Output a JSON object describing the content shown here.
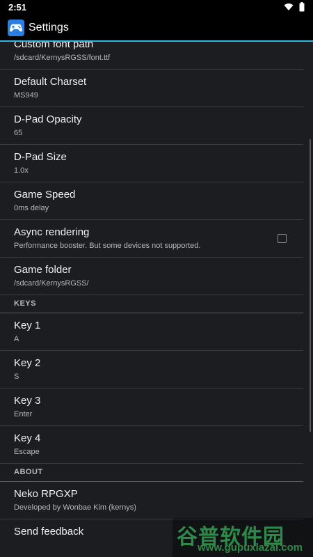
{
  "status_bar": {
    "time": "2:51",
    "icons": [
      "wifi-icon",
      "battery-icon"
    ]
  },
  "action_bar": {
    "title": "Settings",
    "icon": "gamepad-icon",
    "accent": "#33b5e5"
  },
  "preferences_top": [
    {
      "title": "Custom font path",
      "summary": "/sdcard/KernysRGSS/font.ttf"
    },
    {
      "title": "Default Charset",
      "summary": "MS949"
    },
    {
      "title": "D-Pad Opacity",
      "summary": "65"
    },
    {
      "title": "D-Pad Size",
      "summary": "1.0x"
    },
    {
      "title": "Game Speed",
      "summary": "0ms delay"
    },
    {
      "title": "Async rendering",
      "summary": "Performance booster. But some devices not supported.",
      "checked": false
    },
    {
      "title": "Game folder",
      "summary": "/sdcard/KernysRGSS/"
    }
  ],
  "keys_category": "KEYS",
  "keys": [
    {
      "title": "Key 1",
      "summary": "A"
    },
    {
      "title": "Key 2",
      "summary": "S"
    },
    {
      "title": "Key 3",
      "summary": "Enter"
    },
    {
      "title": "Key 4",
      "summary": "Escape"
    }
  ],
  "about_category": "ABOUT",
  "about": [
    {
      "title": "Neko RPGXP",
      "summary": "Developed by Wonbae Kim (kernys)"
    },
    {
      "title": "Send feedback",
      "summary": ""
    }
  ],
  "watermark": {
    "text_cn": "谷普软件园",
    "url": "www.gupuxlazal.com"
  }
}
